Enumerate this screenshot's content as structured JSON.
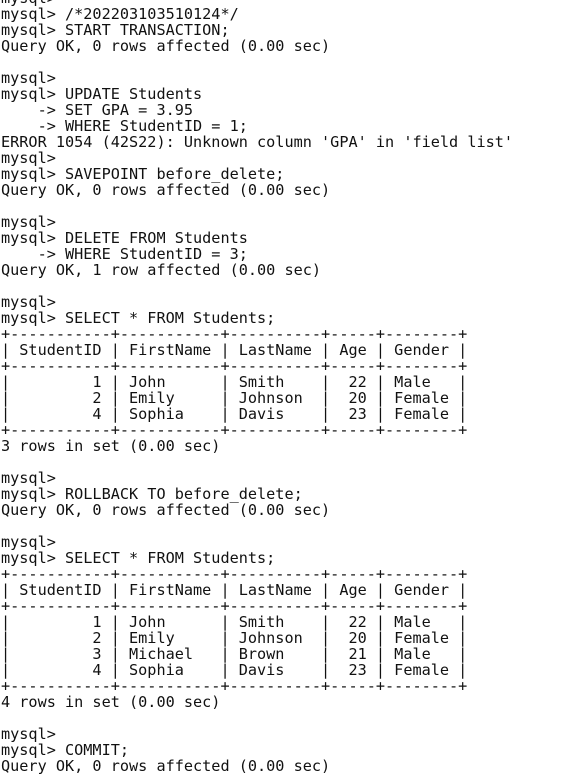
{
  "terminal": {
    "lines": [
      "mysql>",
      "mysql> /*202203103510124*/",
      "mysql> START TRANSACTION;",
      "Query OK, 0 rows affected (0.00 sec)",
      "",
      "mysql>",
      "mysql> UPDATE Students",
      "    -> SET GPA = 3.95",
      "    -> WHERE StudentID = 1;",
      "ERROR 1054 (42S22): Unknown column 'GPA' in 'field list'",
      "mysql>",
      "mysql> SAVEPOINT before_delete;",
      "Query OK, 0 rows affected (0.00 sec)",
      "",
      "mysql>",
      "mysql> DELETE FROM Students",
      "    -> WHERE StudentID = 3;",
      "Query OK, 1 row affected (0.00 sec)",
      "",
      "mysql>",
      "mysql> SELECT * FROM Students;",
      "+-----------+-----------+----------+-----+--------+",
      "| StudentID | FirstName | LastName | Age | Gender |",
      "+-----------+-----------+----------+-----+--------+",
      "|         1 | John      | Smith    |  22 | Male   |",
      "|         2 | Emily     | Johnson  |  20 | Female |",
      "|         4 | Sophia    | Davis    |  23 | Female |",
      "+-----------+-----------+----------+-----+--------+",
      "3 rows in set (0.00 sec)",
      "",
      "mysql>",
      "mysql> ROLLBACK TO before_delete;",
      "Query OK, 0 rows affected (0.00 sec)",
      "",
      "mysql>",
      "mysql> SELECT * FROM Students;",
      "+-----------+-----------+----------+-----+--------+",
      "| StudentID | FirstName | LastName | Age | Gender |",
      "+-----------+-----------+----------+-----+--------+",
      "|         1 | John      | Smith    |  22 | Male   |",
      "|         2 | Emily     | Johnson  |  20 | Female |",
      "|         3 | Michael   | Brown    |  21 | Male   |",
      "|         4 | Sophia    | Davis    |  23 | Female |",
      "+-----------+-----------+----------+-----+--------+",
      "4 rows in set (0.00 sec)",
      "",
      "mysql>",
      "mysql> COMMIT;",
      "Query OK, 0 rows affected (0.00 sec)"
    ]
  }
}
